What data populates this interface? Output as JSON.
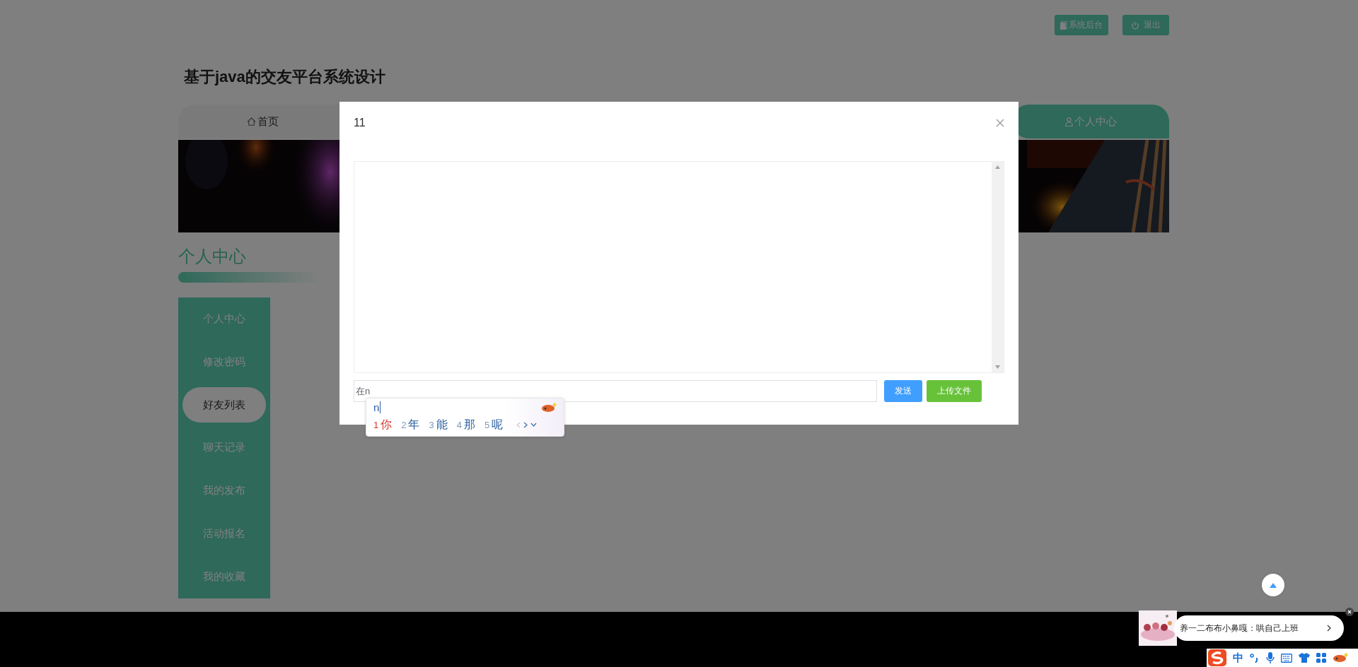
{
  "top_buttons": [
    {
      "label": "系统后台",
      "kind": "admin"
    },
    {
      "label": "退出",
      "kind": "logout"
    }
  ],
  "site_title": "基于java的交友平台系统设计",
  "nav": [
    {
      "label": "首页",
      "kind": "home",
      "selected": false
    },
    {
      "label": "个人中心",
      "kind": "user",
      "selected": true
    }
  ],
  "section_title": "个人中心",
  "sidebar": {
    "items": [
      {
        "label": "个人中心",
        "selected": false
      },
      {
        "label": "修改密码",
        "selected": false
      },
      {
        "label": "好友列表",
        "selected": true
      },
      {
        "label": "聊天记录",
        "selected": false
      },
      {
        "label": "我的发布",
        "selected": false
      },
      {
        "label": "活动报名",
        "selected": false
      },
      {
        "label": "我的收藏",
        "selected": false
      }
    ]
  },
  "dialog": {
    "title": "11",
    "message_input": {
      "value": "在n"
    },
    "buttons": [
      {
        "label": "发送",
        "kind": "primary"
      },
      {
        "label": "上传文件",
        "kind": "success"
      }
    ]
  },
  "ime_popup": {
    "composition": "n",
    "candidates": [
      {
        "index": "1",
        "text": "你",
        "selected": true
      },
      {
        "index": "2",
        "text": "年",
        "selected": false
      },
      {
        "index": "3",
        "text": "能",
        "selected": false
      },
      {
        "index": "4",
        "text": "那",
        "selected": false
      },
      {
        "index": "5",
        "text": "呢",
        "selected": false
      }
    ]
  },
  "notification": {
    "text": "养一二布布小鼻嘎：哄自己上班"
  },
  "ime_toolbar": {
    "mode": "中"
  }
}
